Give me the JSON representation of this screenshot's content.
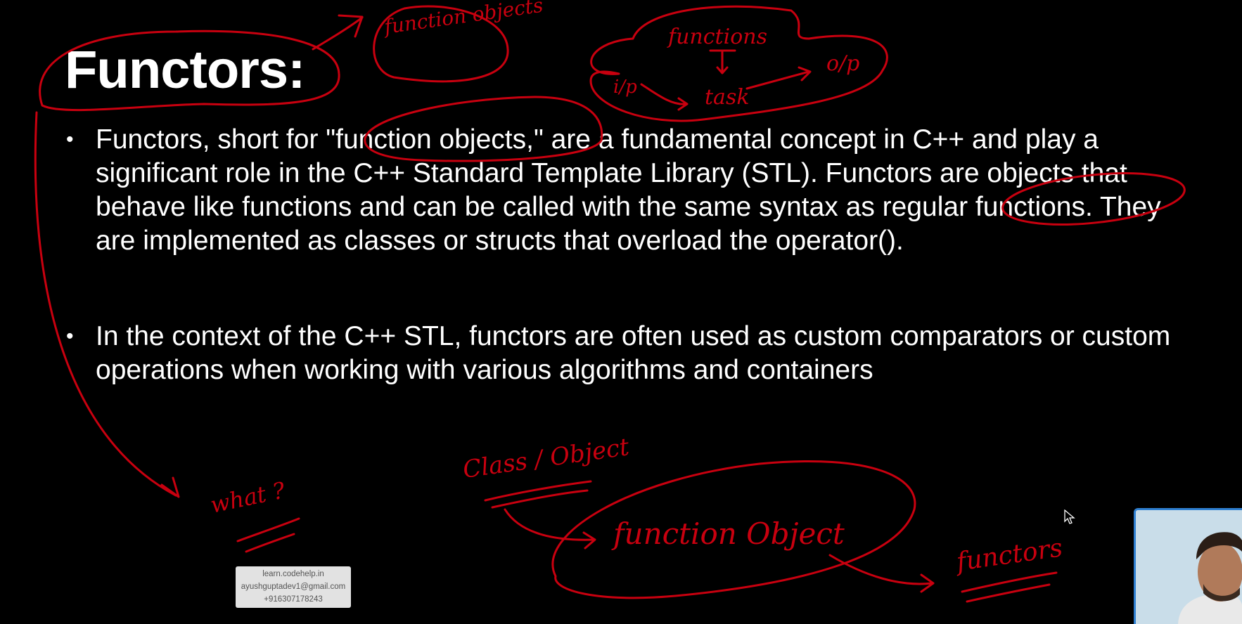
{
  "slide": {
    "title": "Functors:",
    "bullets": [
      "Functors, short for \"function objects,\" are a fundamental concept in C++ and play a significant role in the C++ Standard Template Library (STL). Functors are objects that behave like functions and can be called with the same syntax as regular functions. They are implemented as classes or structs that overload the operator().",
      "In the context of the C++ STL, functors are often used as custom comparators or custom operations when working with various algorithms and containers"
    ],
    "bullet_symbol": "•"
  },
  "annotations": {
    "function_objects": "function objects",
    "functions": "functions",
    "input": "i/p",
    "task": "task",
    "output": "o/p",
    "class_object": "Class / Object",
    "function_object": "function Object",
    "functors": "functors",
    "what": "what ?"
  },
  "watermark": {
    "line1": "learn.codehelp.in",
    "line2": "ayushguptadev1@gmail.com",
    "line3": "+916307178243"
  },
  "colors": {
    "background": "#000000",
    "text": "#ffffff",
    "ink": "#c8000f",
    "webcam_border": "#2f7fd0"
  },
  "icons": [
    "mouse-cursor-icon"
  ]
}
